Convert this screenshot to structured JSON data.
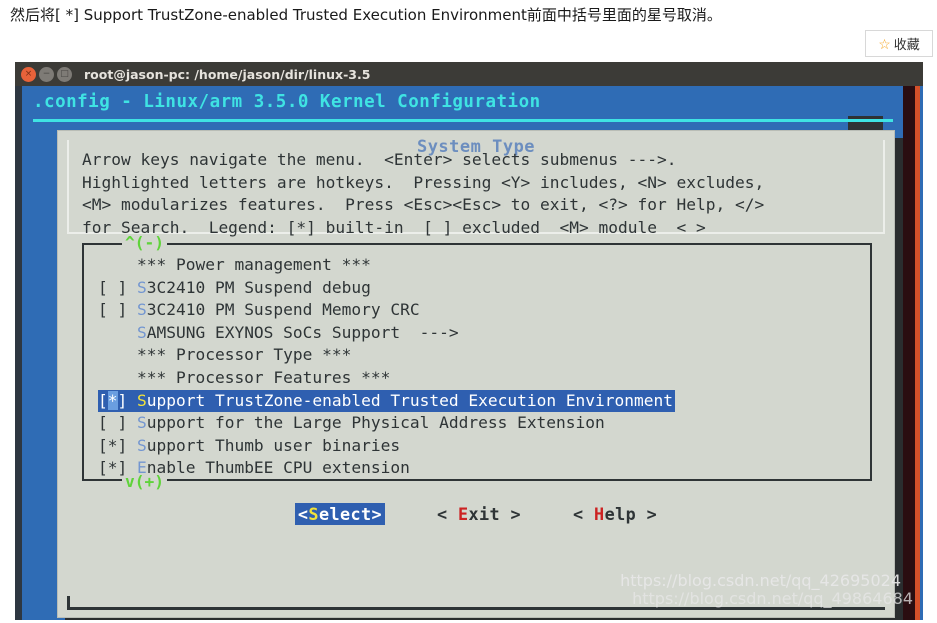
{
  "article": {
    "caption": "然后将[ *] Support TrustZone-enabled Trusted Execution Environment前面中括号里面的星号取消。",
    "favorite_button": {
      "icon": "star-icon",
      "label": "收藏"
    }
  },
  "window": {
    "title": "root@jason-pc: /home/jason/dir/linux-3.5",
    "controls": {
      "close": "×",
      "minimize": "−",
      "maximize": "□"
    }
  },
  "menuconfig": {
    "header": ".config - Linux/arm 3.5.0 Kernel Configuration",
    "dialog_title": "System Type",
    "instructions": "Arrow keys navigate the menu.  <Enter> selects submenus --->.\nHighlighted letters are hotkeys.  Pressing <Y> includes, <N> excludes,\n<M> modularizes features.  Press <Esc><Esc> to exit, <?> for Help, </>\nfor Search.  Legend: [*] built-in  [ ] excluded  <M> module  < >",
    "scroll_up_indicator": "^(-)",
    "scroll_down_indicator": "v(+)",
    "items": [
      {
        "prefix": "    ",
        "hotkey": "",
        "label": "*** Power management ***",
        "selected": false,
        "type": "separator"
      },
      {
        "prefix": "[ ] ",
        "hotkey": "S",
        "label": "3C2410 PM Suspend debug",
        "selected": false,
        "type": "checkbox"
      },
      {
        "prefix": "[ ] ",
        "hotkey": "S",
        "label": "3C2410 PM Suspend Memory CRC",
        "selected": false,
        "type": "checkbox"
      },
      {
        "prefix": "    ",
        "hotkey": "S",
        "label": "AMSUNG EXYNOS SoCs Support  --->",
        "selected": false,
        "type": "submenu"
      },
      {
        "prefix": "    ",
        "hotkey": "",
        "label": "*** Processor Type ***",
        "selected": false,
        "type": "separator"
      },
      {
        "prefix": "    ",
        "hotkey": "",
        "label": "*** Processor Features ***",
        "selected": false,
        "type": "separator"
      },
      {
        "prefix": "[*] ",
        "hotkey": "S",
        "label": "upport TrustZone-enabled Trusted Execution Environment",
        "selected": true,
        "type": "checkbox",
        "checked": true
      },
      {
        "prefix": "[ ] ",
        "hotkey": "S",
        "label": "upport for the Large Physical Address Extension",
        "selected": false,
        "type": "checkbox",
        "checked": false
      },
      {
        "prefix": "[*] ",
        "hotkey": "S",
        "label": "upport Thumb user binaries",
        "selected": false,
        "type": "checkbox",
        "checked": true
      },
      {
        "prefix": "[*] ",
        "hotkey": "E",
        "label": "nable ThumbEE CPU extension",
        "selected": false,
        "type": "checkbox",
        "checked": true
      }
    ],
    "buttons": [
      {
        "pre": "<",
        "hotkey": "S",
        "post": "elect>",
        "primary": true
      },
      {
        "pre": "< ",
        "hotkey": "E",
        "post": "xit >",
        "primary": false
      },
      {
        "pre": "< ",
        "hotkey": "H",
        "post": "elp >",
        "primary": false
      }
    ]
  },
  "watermarks": [
    "https://blog.csdn.net/qq_42695024",
    "https://blog.csdn.net/qq_49864684"
  ],
  "colors": {
    "terminal_blue": "#2f6cb5",
    "cyan_title": "#3fe3e3",
    "panel_gray": "#d3d7cf",
    "select_blue": "#2f5fb0",
    "hotkey_blue": "#7396d0",
    "hotkey_yellow": "#f2e23a",
    "hotkey_red": "#cc2222",
    "scroll_green": "#5fd33a",
    "dialog_title_blue": "#6c8ebf",
    "close_orange": "#e8623a"
  }
}
